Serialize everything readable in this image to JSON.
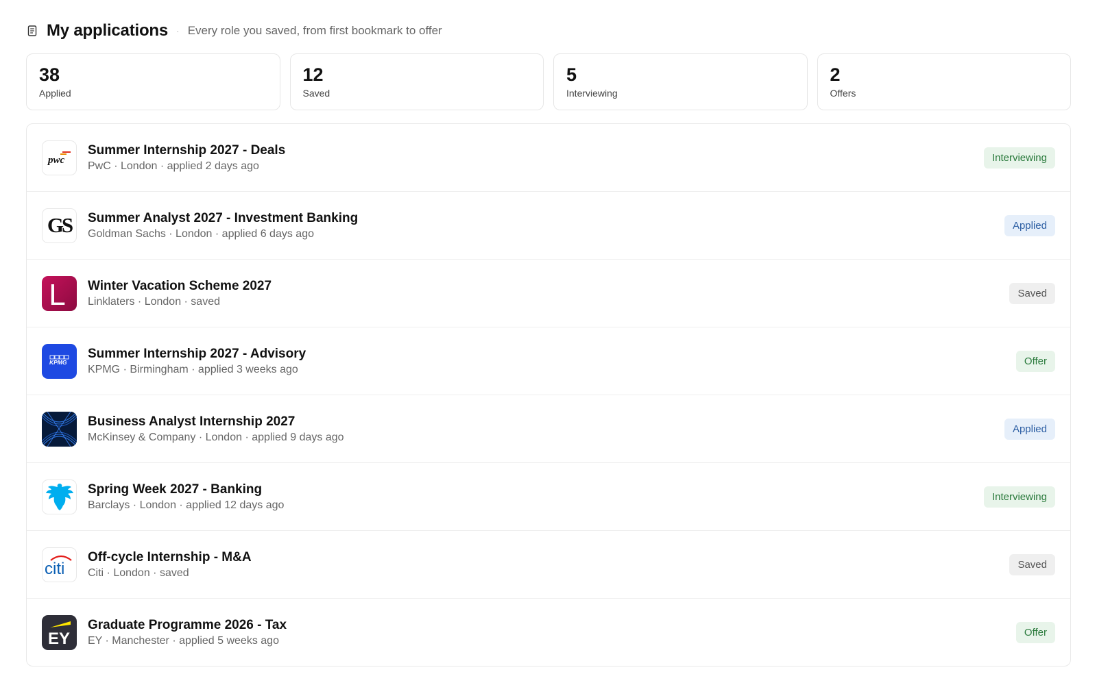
{
  "header": {
    "icon": "document-list-icon",
    "title": "My applications",
    "separator": "·",
    "subtitle": "Every role you saved, from first bookmark to offer"
  },
  "stats": [
    {
      "value": "38",
      "label": "Applied"
    },
    {
      "value": "12",
      "label": "Saved"
    },
    {
      "value": "5",
      "label": "Interviewing"
    },
    {
      "value": "2",
      "label": "Offers"
    }
  ],
  "applications": [
    {
      "title": "Summer Internship 2027 - Deals",
      "meta": "PwC · London · applied 2 days ago",
      "status": "Interviewing",
      "logo": "pwc-logo",
      "logo_text": "pwc"
    },
    {
      "title": "Summer Analyst 2027 - Investment Banking",
      "meta": "Goldman Sachs · London · applied 6 days ago",
      "status": "Applied",
      "logo": "goldman-sachs-logo",
      "logo_text": "GS"
    },
    {
      "title": "Winter Vacation Scheme 2027",
      "meta": "Linklaters · London · saved",
      "status": "Saved",
      "logo": "linklaters-logo",
      "logo_text": "L"
    },
    {
      "title": "Summer Internship 2027 - Advisory",
      "meta": "KPMG · Birmingham · applied 3 weeks ago",
      "status": "Offer",
      "logo": "kpmg-logo",
      "logo_text": "KPMG"
    },
    {
      "title": "Business Analyst Internship 2027",
      "meta": "McKinsey & Company · London · applied 9 days ago",
      "status": "Applied",
      "logo": "mckinsey-logo",
      "logo_text": ""
    },
    {
      "title": "Spring Week 2027 - Banking",
      "meta": "Barclays · London · applied 12 days ago",
      "status": "Interviewing",
      "logo": "barclays-eagle-logo",
      "logo_text": ""
    },
    {
      "title": "Off-cycle Internship - M&A",
      "meta": "Citi · London · saved",
      "status": "Saved",
      "logo": "citi-logo",
      "logo_text": "citi"
    },
    {
      "title": "Graduate Programme 2026 - Tax",
      "meta": "EY · Manchester · applied 5 weeks ago",
      "status": "Offer",
      "logo": "ey-logo",
      "logo_text": "EY"
    }
  ],
  "colors": {
    "interviewing_bg": "#e8f4ea",
    "applied_bg": "#e6effa",
    "saved_bg": "#efefef",
    "offer_bg": "#e8f4ea"
  }
}
